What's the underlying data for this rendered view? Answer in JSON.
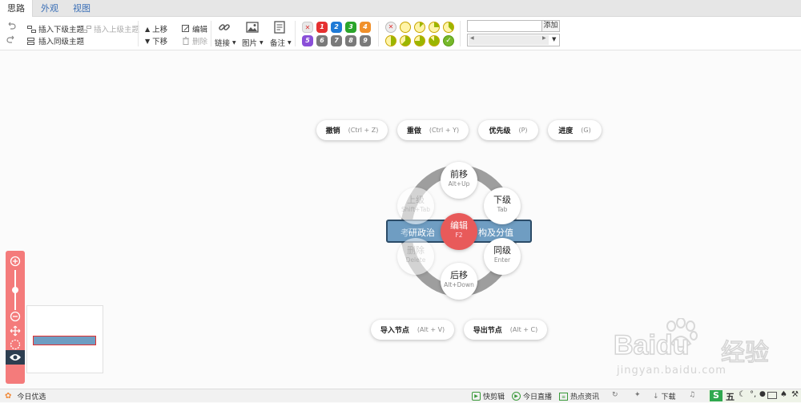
{
  "tabs": [
    "思路",
    "外观",
    "视图"
  ],
  "toolbar": {
    "insert_child": "插入下级主题",
    "insert_parent": "插入上级主题",
    "insert_sibling": "插入同级主题",
    "move_up": "上移",
    "move_down": "下移",
    "edit": "编辑",
    "delete": "删除",
    "link": "链接",
    "image": "图片",
    "note": "备注",
    "priorities": [
      "1",
      "2",
      "3",
      "4",
      "5",
      "6",
      "7",
      "8",
      "9"
    ],
    "add_label": "添加"
  },
  "shortcuts": [
    {
      "label": "撤销",
      "key": "(Ctrl + Z)"
    },
    {
      "label": "重做",
      "key": "(Ctrl + Y)"
    },
    {
      "label": "优先级",
      "key": "(P)"
    },
    {
      "label": "进度",
      "key": "(G)"
    }
  ],
  "node": {
    "left_text": "考",
    "mid_text": "研政治",
    "right_text": "构及分值"
  },
  "radial": {
    "center": {
      "label": "编辑",
      "key": "F2"
    },
    "top": {
      "label": "前移",
      "key": "Alt+Up"
    },
    "right_top": {
      "label": "下级",
      "key": "Tab"
    },
    "right_bottom": {
      "label": "同级",
      "key": "Enter"
    },
    "bottom": {
      "label": "后移",
      "key": "Alt+Down"
    },
    "left_top": {
      "label": "上级",
      "key": "Shift+Tab"
    },
    "left_bottom": {
      "label": "删除",
      "key": "Delete"
    }
  },
  "bottom_actions": [
    {
      "label": "导入节点",
      "key": "(Alt + V)"
    },
    {
      "label": "导出节点",
      "key": "(Alt + C)"
    }
  ],
  "statusbar": {
    "left": "今日优选",
    "items": [
      "快剪辑",
      "今日直播",
      "热点资讯",
      "下载"
    ]
  },
  "watermark": {
    "brand": "Baidu",
    "sub": "经验",
    "url": "jingyan.baidu.com"
  },
  "ime": {
    "label": "五"
  }
}
